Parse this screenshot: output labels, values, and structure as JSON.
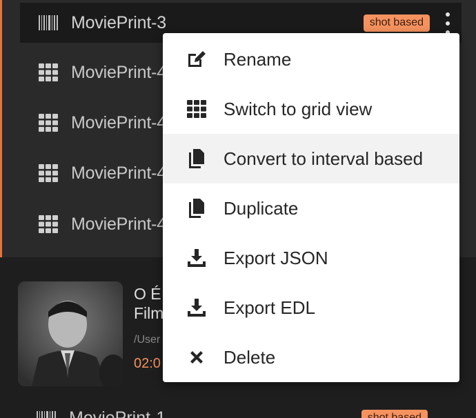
{
  "print_list": {
    "active_item": {
      "label": "MoviePrint-3",
      "badge": "shot based",
      "icon": "barcode-icon"
    },
    "items": [
      {
        "label": "MoviePrint-4",
        "icon": "grid-icon"
      },
      {
        "label": "MoviePrint-4",
        "icon": "grid-icon"
      },
      {
        "label": "MoviePrint-4",
        "icon": "grid-icon"
      },
      {
        "label": "MoviePrint-4",
        "icon": "grid-icon"
      }
    ]
  },
  "movie": {
    "title_line1": "O É",
    "title_line2": "Film",
    "path": "/User",
    "duration": "02:0"
  },
  "bottom_item": {
    "label": "MoviePrint-1",
    "badge": "shot based"
  },
  "menu": {
    "items": [
      {
        "label": "Rename",
        "icon": "edit-icon"
      },
      {
        "label": "Switch to grid view",
        "icon": "grid-icon"
      },
      {
        "label": "Convert to interval based",
        "icon": "copy-icon"
      },
      {
        "label": "Duplicate",
        "icon": "copy-icon"
      },
      {
        "label": "Export JSON",
        "icon": "download-icon"
      },
      {
        "label": "Export EDL",
        "icon": "download-icon"
      },
      {
        "label": "Delete",
        "icon": "close-icon"
      }
    ]
  },
  "colors": {
    "accent": "#e8743b",
    "badge_bg": "#f5925f",
    "panel_bg": "#2a2a2a",
    "menu_bg": "#ffffff"
  }
}
